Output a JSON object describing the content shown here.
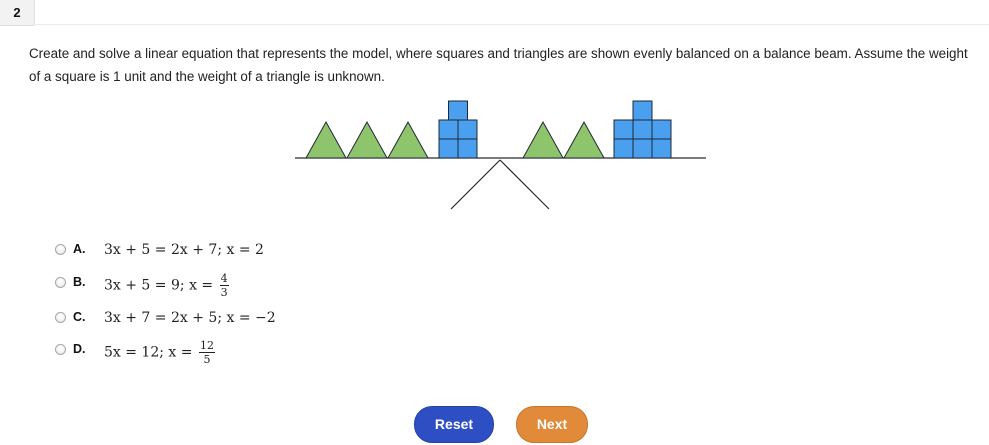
{
  "question": {
    "number": "2",
    "prompt": "Create and solve a linear equation that represents the model, where squares and triangles are shown evenly balanced on a balance beam. Assume the weight of a square is 1 unit and the weight of a triangle is unknown."
  },
  "model": {
    "left": {
      "triangles": 3,
      "squares": 5
    },
    "right": {
      "triangles": 2,
      "squares": 7
    },
    "colors": {
      "triangle": "#8ec46b",
      "square": "#4aa0ee",
      "outline": "#1f2a36"
    }
  },
  "choices": [
    {
      "letter": "A.",
      "eq1": "3x + 5 = 2x + 7;",
      "solution": "x = 2"
    },
    {
      "letter": "B.",
      "eq1": "3x + 5 = 9;",
      "solution_prefix": "x =",
      "numerator": "4",
      "denominator": "3"
    },
    {
      "letter": "C.",
      "eq1": "3x + 7 = 2x + 5;",
      "solution": "x = −2"
    },
    {
      "letter": "D.",
      "eq1": "5x = 12;",
      "solution_prefix": "x =",
      "numerator": "12",
      "denominator": "5"
    }
  ],
  "buttons": {
    "reset": "Reset",
    "next": "Next"
  }
}
